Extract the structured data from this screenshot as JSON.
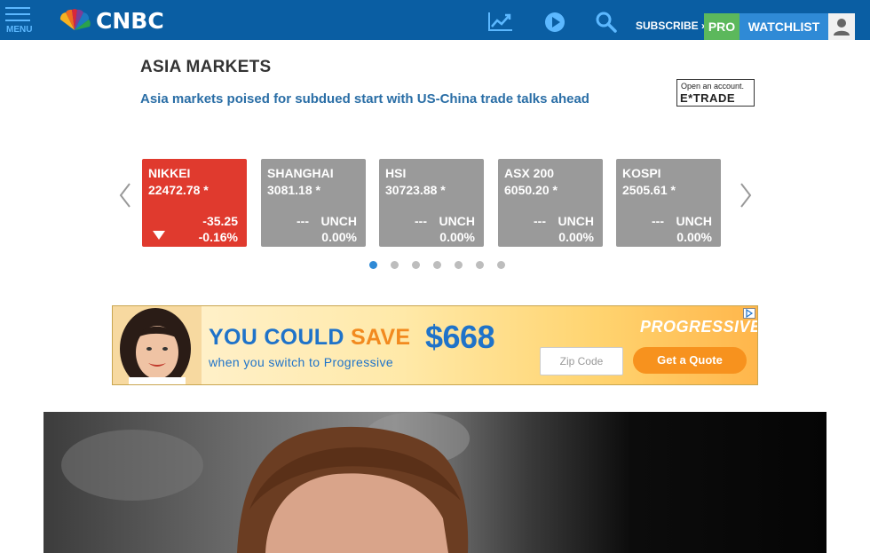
{
  "nav": {
    "menu_label": "MENU",
    "logo_text": "CNBC",
    "subscribe_label": "SUBSCRIBE ›",
    "pro_label": "PRO",
    "watchlist_label": "WATCHLIST",
    "icons": [
      "menu-icon",
      "peacock-logo-icon",
      "chart-icon",
      "play-icon",
      "search-icon",
      "user-icon"
    ]
  },
  "section": {
    "title": "ASIA MARKETS",
    "headline": "Asia markets poised for subdued start with US-China trade talks ahead"
  },
  "sponsor": {
    "tagline": "Open an account.",
    "brand": "E*TRADE"
  },
  "markets": [
    {
      "name": "NIKKEI",
      "price": "22472.78 *",
      "change": "-35.25",
      "percent": "-0.16%",
      "status": "down"
    },
    {
      "name": "SHANGHAI",
      "price": "3081.18 *",
      "change": "UNCH",
      "percent": "0.00%",
      "status": "flat",
      "dashes": "---"
    },
    {
      "name": "HSI",
      "price": "30723.88 *",
      "change": "UNCH",
      "percent": "0.00%",
      "status": "flat",
      "dashes": "---"
    },
    {
      "name": "ASX 200",
      "price": "6050.20 *",
      "change": "UNCH",
      "percent": "0.00%",
      "status": "flat",
      "dashes": "---"
    },
    {
      "name": "KOSPI",
      "price": "2505.61 *",
      "change": "UNCH",
      "percent": "0.00%",
      "status": "flat",
      "dashes": "---"
    }
  ],
  "carousel": {
    "page_count": 7,
    "active_page": 1
  },
  "ad": {
    "line1_a": "YOU COULD",
    "line1_b": "SAVE",
    "amount": "$668",
    "line2": "when you switch to Progressive",
    "brand": "PROGRESSIVE",
    "zip_placeholder": "Zip Code",
    "cta": "Get a Quote"
  },
  "colors": {
    "nav_bg": "#0a5ea3",
    "down": "#e03a2e",
    "flat": "#9a9a9a",
    "pro": "#5cb85c",
    "watchlist": "#2f8ad6"
  }
}
